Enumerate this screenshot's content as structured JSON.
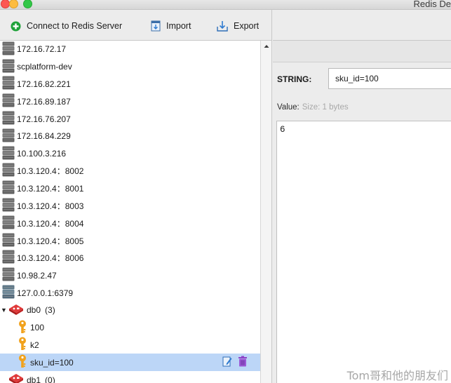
{
  "window": {
    "title": "Redis De"
  },
  "toolbar": {
    "connect_label": "Connect to Redis Server",
    "import_label": "Import",
    "export_label": "Export"
  },
  "tree": {
    "servers": [
      {
        "label": "172.16.72.17"
      },
      {
        "label": "scplatform-dev"
      },
      {
        "label": "172.16.82.221"
      },
      {
        "label": "172.16.89.187"
      },
      {
        "label": "172.16.76.207"
      },
      {
        "label": "172.16.84.229"
      },
      {
        "label": "10.100.3.216"
      },
      {
        "label": "10.3.120.4：8002"
      },
      {
        "label": "10.3.120.4：8001"
      },
      {
        "label": "10.3.120.4：8003"
      },
      {
        "label": "10.3.120.4：8004"
      },
      {
        "label": "10.3.120.4：8005"
      },
      {
        "label": "10.3.120.4：8006"
      },
      {
        "label": "10.98.2.47"
      },
      {
        "label": "127.0.0.1:6379"
      }
    ],
    "db0": {
      "label": "db0",
      "count": "(3)"
    },
    "keys": [
      {
        "label": "100"
      },
      {
        "label": "k2"
      },
      {
        "label": "sku_id=100"
      }
    ],
    "db1": {
      "label": "db1",
      "count": "(0)"
    }
  },
  "detail": {
    "type_label": "STRING:",
    "key_value": "sku_id=100",
    "value_label": "Value:",
    "size_text": "Size: 1 bytes",
    "value": "6"
  },
  "watermark": "Tom哥和他的朋友们",
  "colors": {
    "selected_row": "#bcd6f7",
    "key_icon": "#f1a21d",
    "db_icon": "#d42a2a",
    "connect_icon": "#1fa23a"
  }
}
